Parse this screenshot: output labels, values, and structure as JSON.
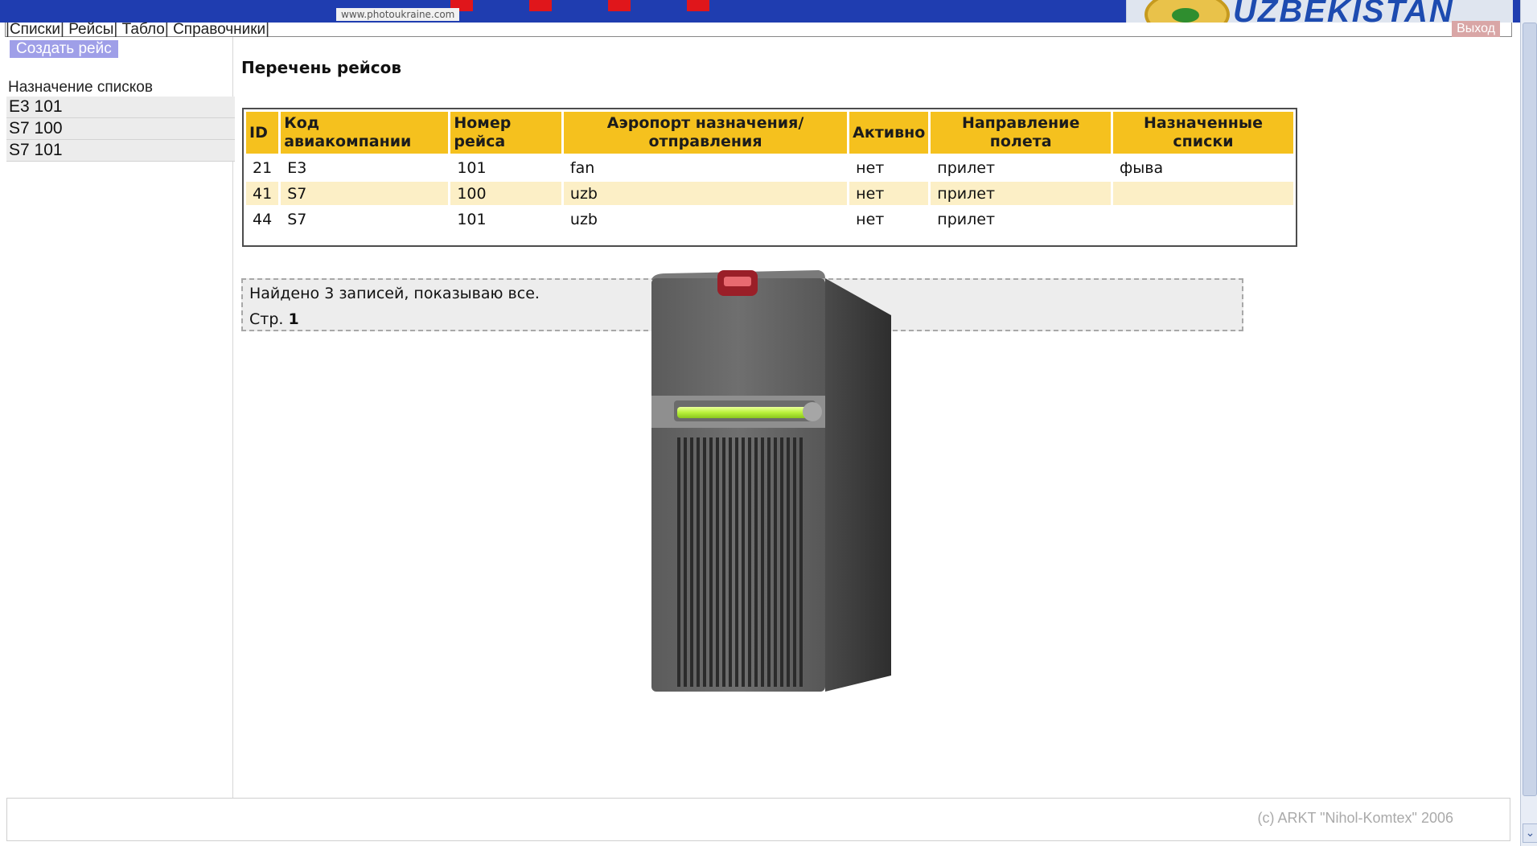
{
  "banner": {
    "watermark": "www.photoukraine.com",
    "logo_text": "UZBEKISTAN"
  },
  "menu": {
    "items": [
      {
        "label": "Списки"
      },
      {
        "label": "Рейсы"
      },
      {
        "label": "Табло"
      },
      {
        "label": "Справочники"
      }
    ],
    "separator": "|",
    "logout": "Выход"
  },
  "sidebar": {
    "create_button": "Создать рейс",
    "lists_title": "Назначение списков",
    "items": [
      {
        "label": "E3 101"
      },
      {
        "label": "S7 100"
      },
      {
        "label": "S7 101"
      }
    ]
  },
  "main": {
    "title": "Перечень рейсов",
    "table": {
      "headers": [
        "ID",
        "Код авиакомпании",
        "Номер рейса",
        "Аэропорт назначения/отправления",
        "Активно",
        "Направление полета",
        "Назначенные списки"
      ],
      "rows": [
        [
          "21",
          "E3",
          "101",
          "fan",
          "нет",
          "прилет",
          "фыва"
        ],
        [
          "41",
          "S7",
          "100",
          "uzb",
          "нет",
          "прилет",
          ""
        ],
        [
          "44",
          "S7",
          "101",
          "uzb",
          "нет",
          "прилет",
          ""
        ]
      ]
    },
    "found_text": "Найдено 3 записей, показываю все.",
    "page_label": "Стр.",
    "page_number": "1"
  },
  "footer": {
    "copyright": "(c) ARKT \"Nihol-Komtex\" 2006"
  },
  "colors": {
    "banner": "#1f3db0",
    "header_accent": "#f5c11e",
    "row_alt": "#fcefc6",
    "button": "#9f9fe8"
  }
}
